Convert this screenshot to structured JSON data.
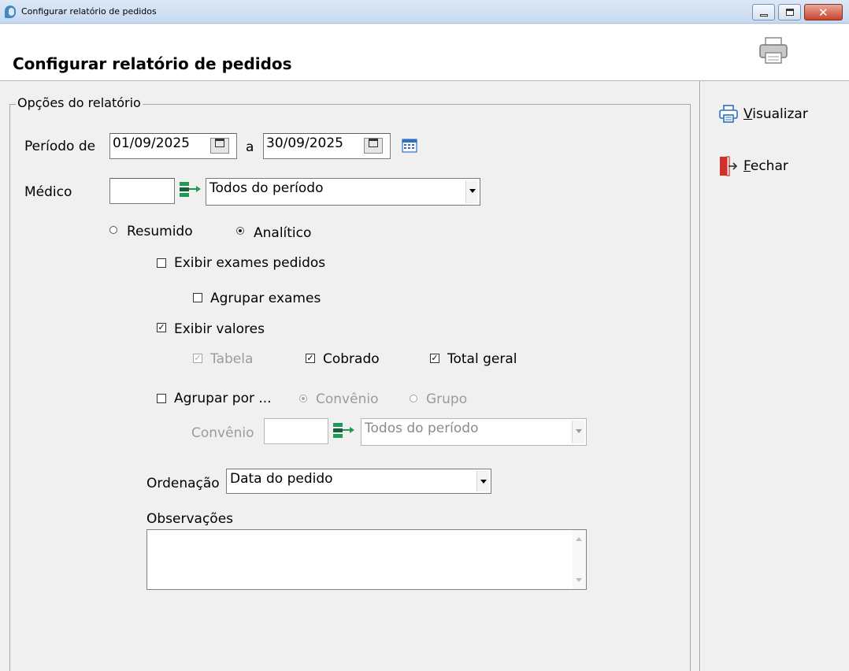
{
  "window": {
    "title": "Configurar relatório de pedidos",
    "minimize_label": "minimize",
    "maximize_label": "maximize",
    "close_glyph": "✕"
  },
  "header": {
    "title": "Configurar relatório de pedidos",
    "icon": "printer-icon"
  },
  "actions": [
    {
      "label": "Visualizar",
      "accel": "V",
      "rest": "isualizar",
      "icon": "printer-icon"
    },
    {
      "label": "Fechar",
      "accel": "F",
      "rest": "echar",
      "icon": "exit-door-icon"
    }
  ],
  "report_options": {
    "legend": "Opções do relatório",
    "periodo": {
      "label": "Período de",
      "start": "01/09/2025",
      "separator": "a",
      "end": "30/09/2025"
    },
    "medico": {
      "label": "Médico",
      "code": "",
      "selected": "Todos do período"
    },
    "mode": {
      "options": [
        {
          "label": "Resumido",
          "selected": false
        },
        {
          "label": "Analítico",
          "selected": true
        }
      ]
    },
    "exibir_exames": {
      "label": "Exibir exames pedidos",
      "checked": false
    },
    "agrupar_exames": {
      "label": "Agrupar exames",
      "checked": false
    },
    "exibir_valores": {
      "label": "Exibir valores",
      "checked": true
    },
    "valores": [
      {
        "label": "Tabela",
        "checked": true,
        "enabled": false
      },
      {
        "label": "Cobrado",
        "checked": true,
        "enabled": true
      },
      {
        "label": "Total geral",
        "checked": true,
        "enabled": true
      }
    ],
    "agrupar_por": {
      "label": "Agrupar por ...",
      "checked": false,
      "options": [
        {
          "label": "Convênio",
          "selected": true
        },
        {
          "label": "Grupo",
          "selected": false
        }
      ]
    },
    "convenio": {
      "label": "Convênio",
      "code": "",
      "selected": "Todos do período"
    },
    "ordenacao": {
      "label": "Ordenação",
      "selected": "Data do pedido"
    },
    "observacoes": {
      "label": "Observações",
      "value": ""
    }
  },
  "colors": {
    "accent_blue": "#2e6fc0",
    "exit_red": "#d3302a",
    "lookup_green": "#1f9a55"
  }
}
